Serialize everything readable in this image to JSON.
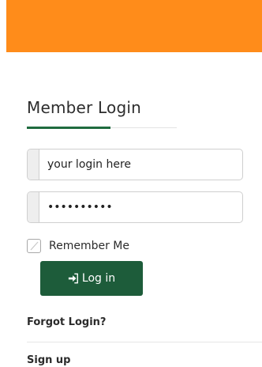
{
  "colors": {
    "banner": "#ff8c1a",
    "accent": "#1f6b3f",
    "button": "#1d5c3a"
  },
  "login": {
    "title": "Member Login",
    "username_placeholder": "your login here",
    "password_value": "••••••••••",
    "remember_label": "Remember Me",
    "remember_checked": false,
    "button_label": "Log in",
    "button_icon": "sign-in-icon"
  },
  "links": {
    "forgot": "Forgot Login?",
    "signup": "Sign up"
  }
}
